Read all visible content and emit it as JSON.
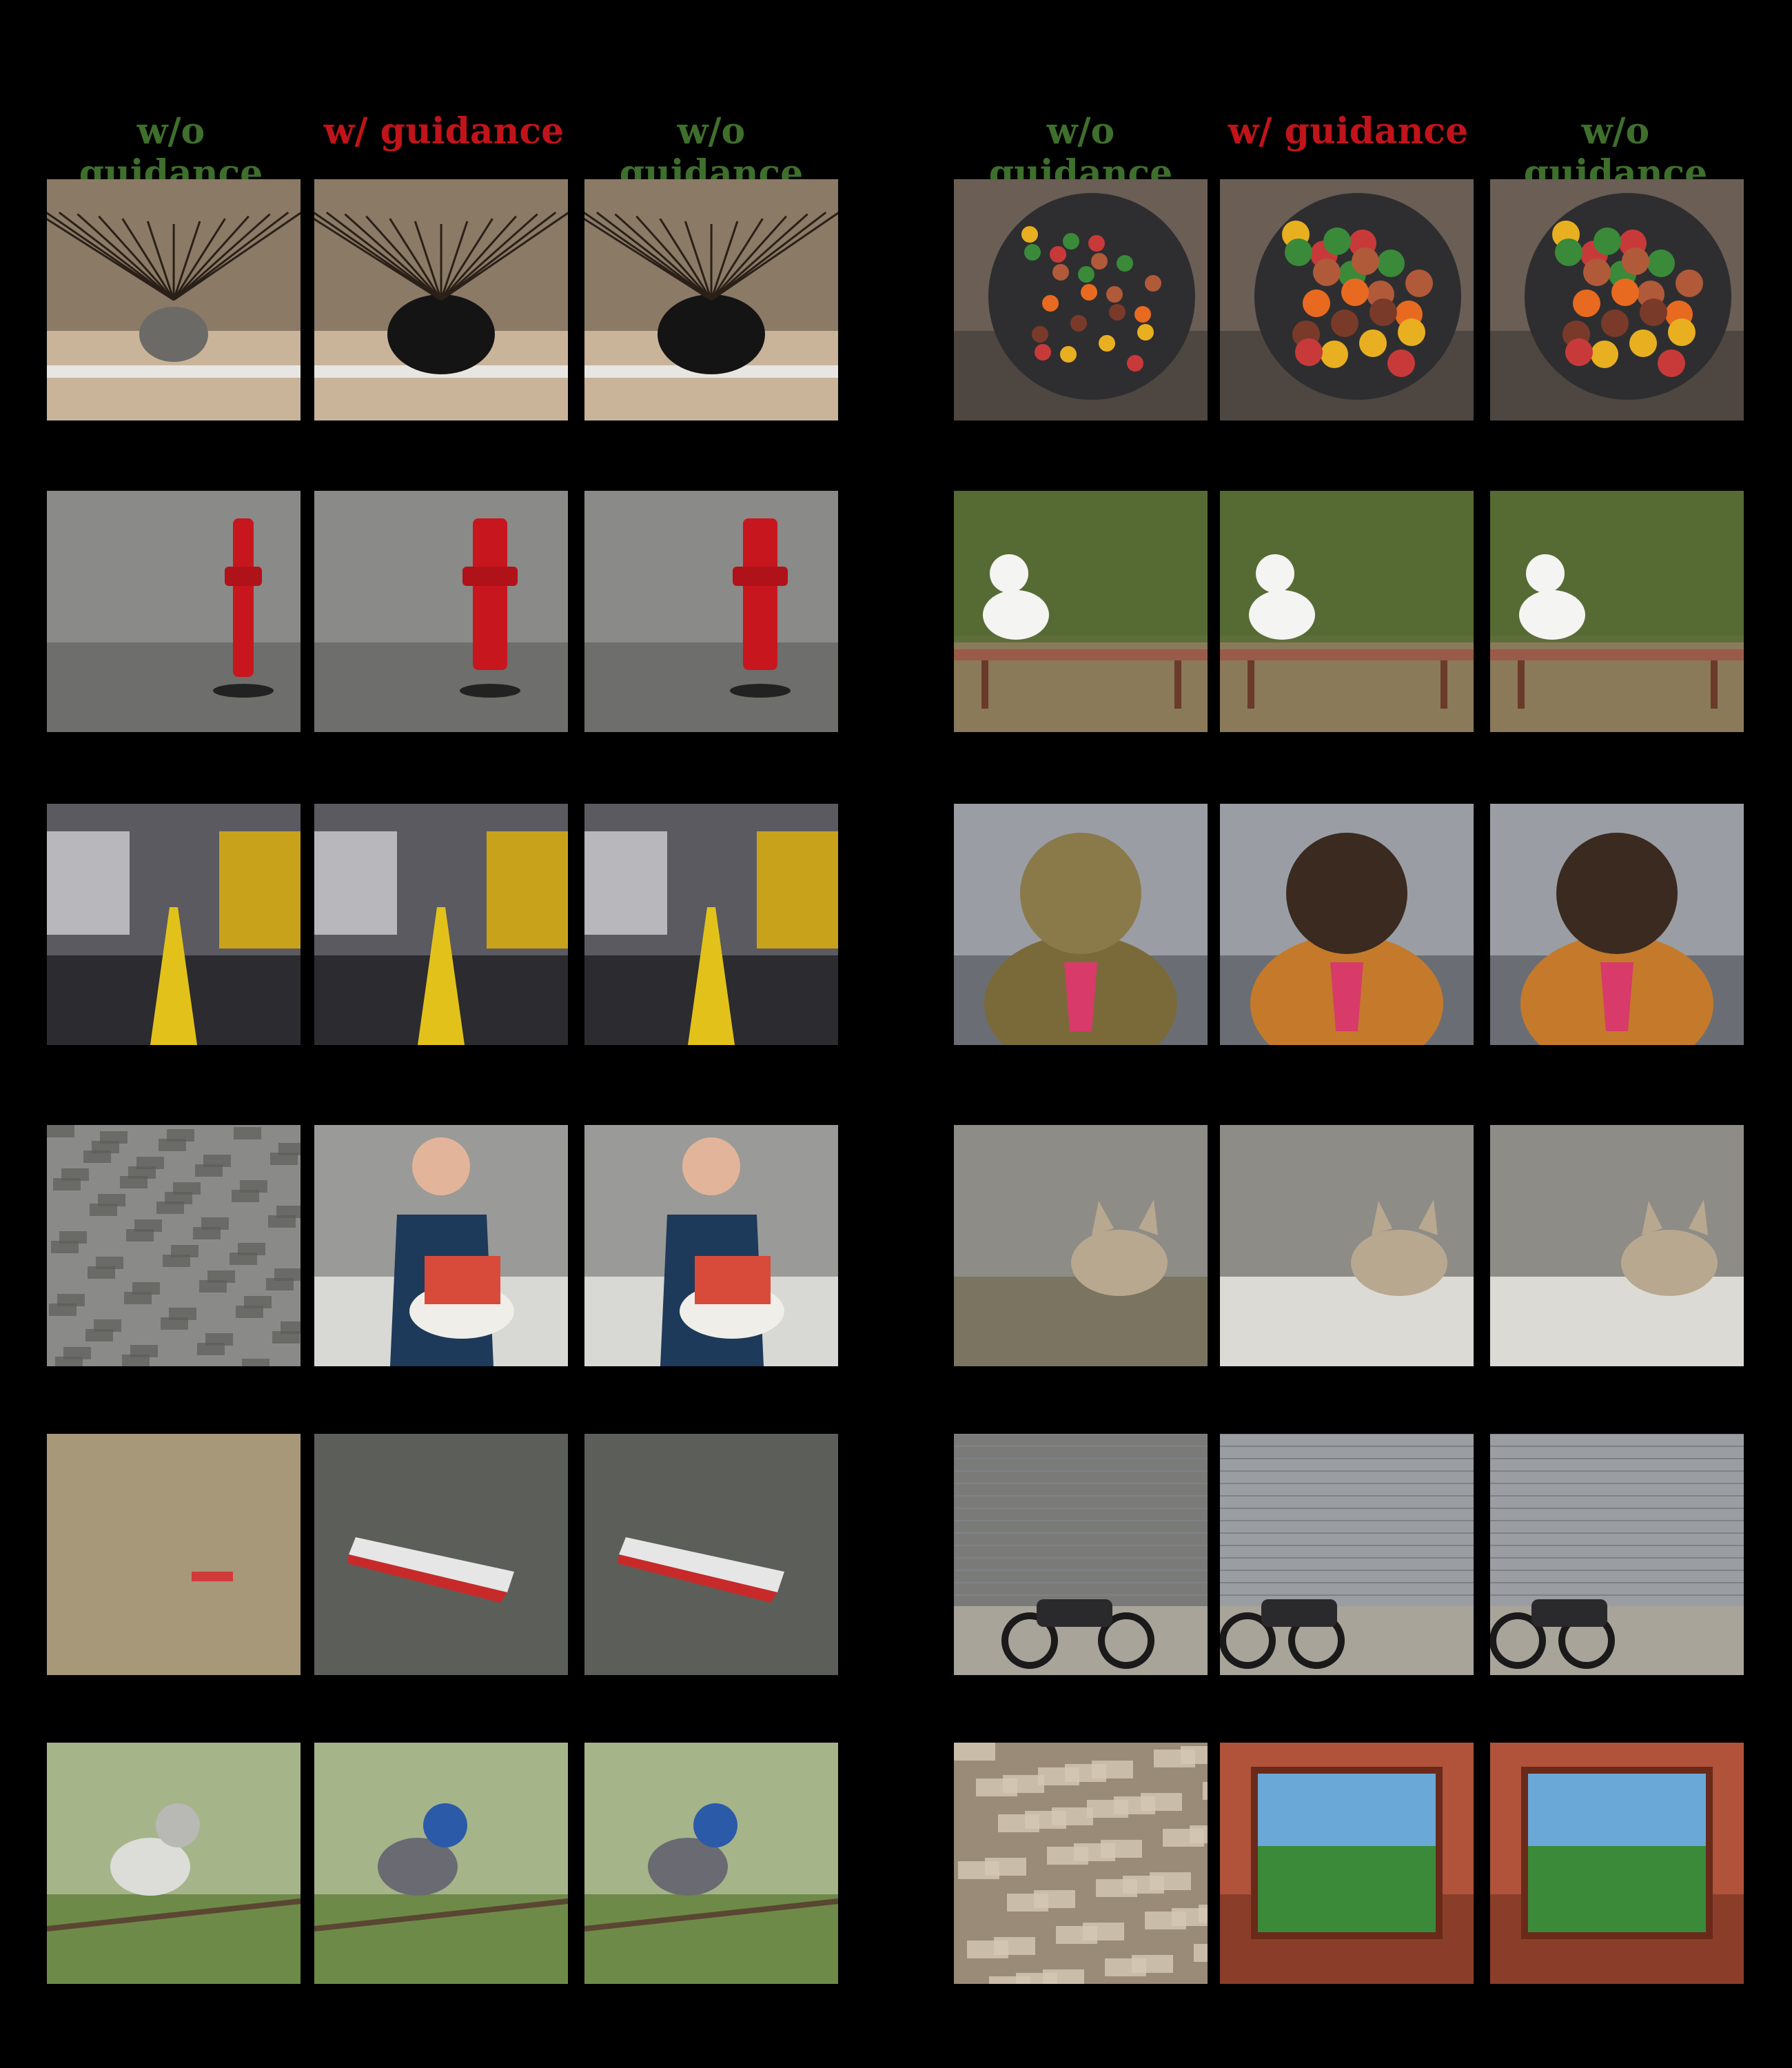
{
  "headers": {
    "left": [
      "w/o guidance",
      "w/ guidance",
      "w/o guidance"
    ],
    "right": [
      "w/o guidance",
      "w/ guidance",
      "w/o guidance"
    ]
  },
  "colors": {
    "green_label": "#3f6f2c",
    "red_label": "#c0141a",
    "background": "#000000"
  },
  "rows_left": [
    [
      "vase-with-dry-branches-photo",
      "vase-with-dry-branches-photo",
      "vase-with-dry-branches-photo"
    ],
    [
      "red-fire-hydrant-photo",
      "red-fire-hydrant-photo",
      "red-fire-hydrant-photo"
    ],
    [
      "train-platform-photo",
      "train-platform-photo",
      "train-platform-photo"
    ],
    [
      "woman-holding-cake-photo",
      "woman-holding-cake-photo",
      "woman-holding-cake-photo"
    ],
    [
      "boat-on-water-photo",
      "boat-on-water-photo",
      "boat-on-water-photo"
    ],
    [
      "bird-on-branch-photo",
      "bird-on-branch-photo",
      "bird-on-branch-photo"
    ]
  ],
  "rows_right": [
    [
      "food-platter-photo",
      "food-platter-photo",
      "food-platter-photo"
    ],
    [
      "dog-on-bench-photo",
      "dog-on-bench-photo",
      "dog-on-bench-photo"
    ],
    [
      "dog-wearing-tie-photo",
      "dog-wearing-tie-photo",
      "dog-wearing-tie-photo"
    ],
    [
      "kitten-on-chair-photo",
      "kitten-on-chair-photo",
      "kitten-on-chair-photo"
    ],
    [
      "motorcycle-by-wall-photo",
      "motorcycle-by-wall-photo",
      "motorcycle-by-wall-photo"
    ],
    [
      "window-view-photo",
      "window-view-photo",
      "window-view-photo"
    ]
  ]
}
